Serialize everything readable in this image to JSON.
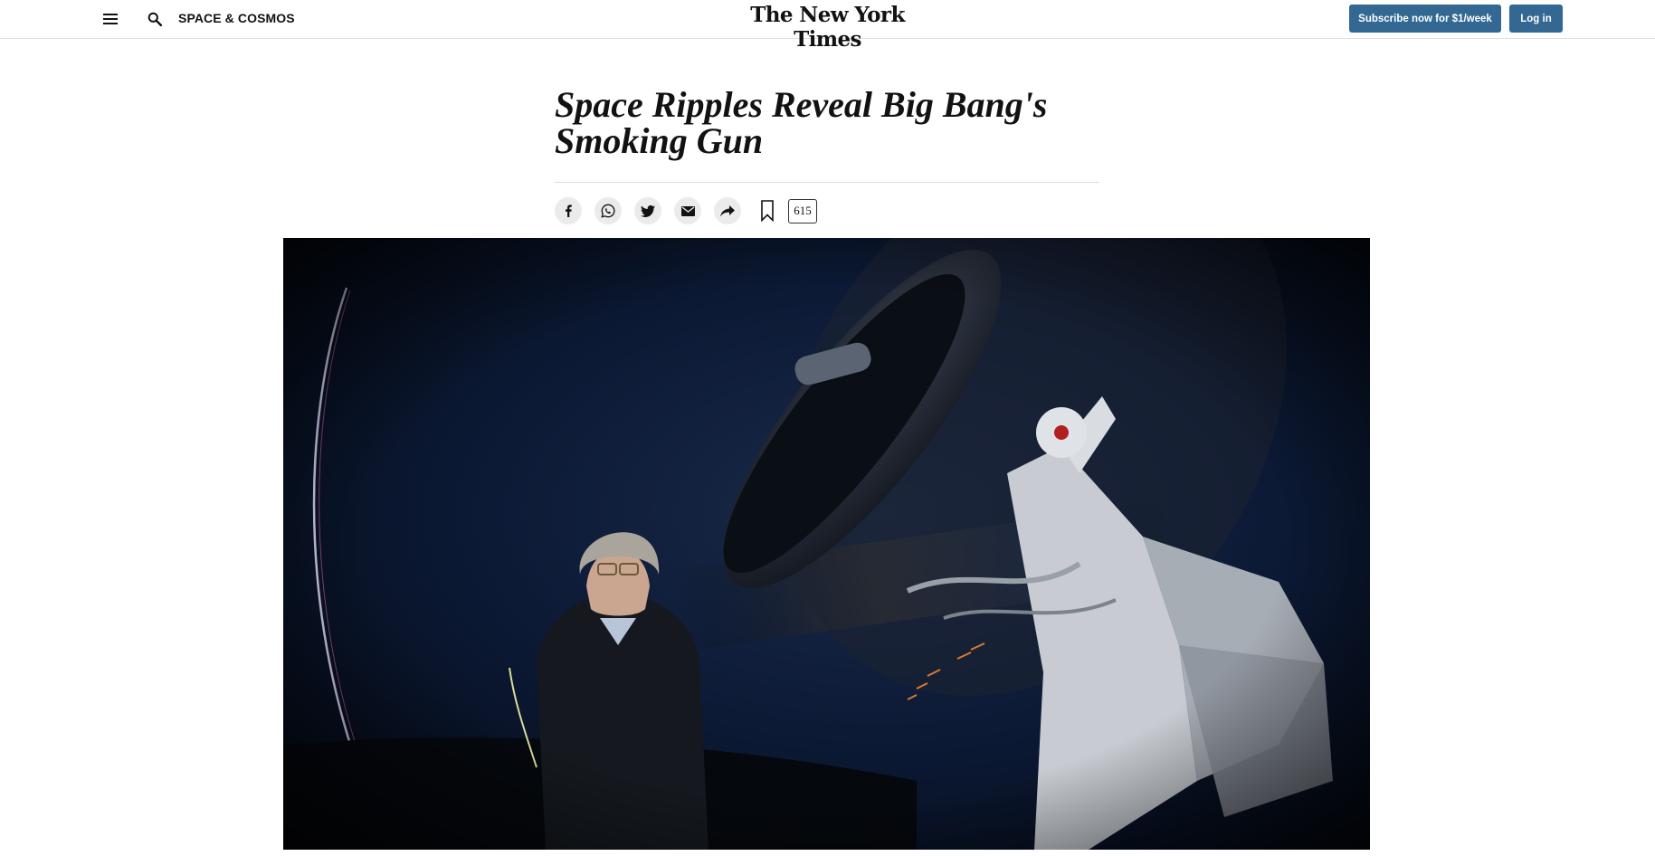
{
  "header": {
    "section_label": "SPACE & COSMOS",
    "logo_text": "The New York Times",
    "subscribe_label": "Subscribe now for $1/week",
    "login_label": "Log in",
    "icons": [
      "menu-icon",
      "search-icon"
    ]
  },
  "article": {
    "headline": "Space Ripples Reveal Big Bang's Smoking Gun",
    "comment_count": "615"
  },
  "share_tools": {
    "icons": [
      "facebook-icon",
      "whatsapp-icon",
      "twitter-icon",
      "email-icon",
      "share-icon",
      "bookmark-icon"
    ]
  },
  "colors": {
    "accent": "#326891",
    "text": "#121212",
    "share_bg": "#ebebeb"
  }
}
